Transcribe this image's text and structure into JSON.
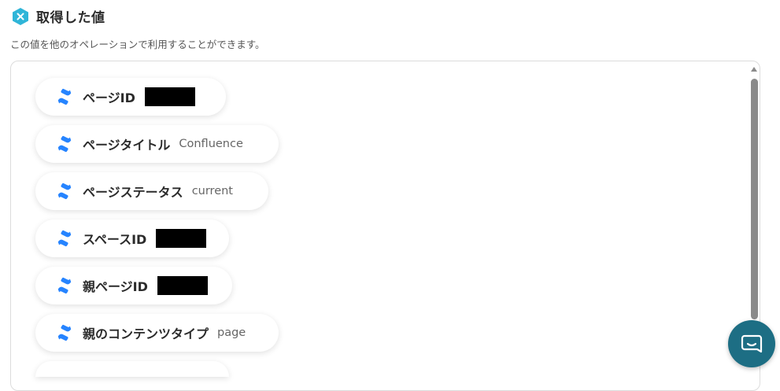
{
  "header": {
    "title": "取得した値",
    "subtitle": "この値を他のオペレーションで利用することができます。"
  },
  "items": [
    {
      "label": "ページID",
      "value": "",
      "redacted": true
    },
    {
      "label": "ページタイトル",
      "value": "Confluence",
      "redacted": false
    },
    {
      "label": "ページステータス",
      "value": "current",
      "redacted": false
    },
    {
      "label": "スペースID",
      "value": "",
      "redacted": true
    },
    {
      "label": "親ページID",
      "value": "",
      "redacted": true
    },
    {
      "label": "親のコンテンツタイプ",
      "value": "page",
      "redacted": false
    }
  ],
  "icons": {
    "header_icon": "yoom-hexagon-icon",
    "item_icon": "confluence-icon",
    "chat": "chat-icon"
  },
  "colors": {
    "hex_icon": "#2fb5d8",
    "confluence": "#2684ff",
    "chat_button": "#1d6e84"
  }
}
